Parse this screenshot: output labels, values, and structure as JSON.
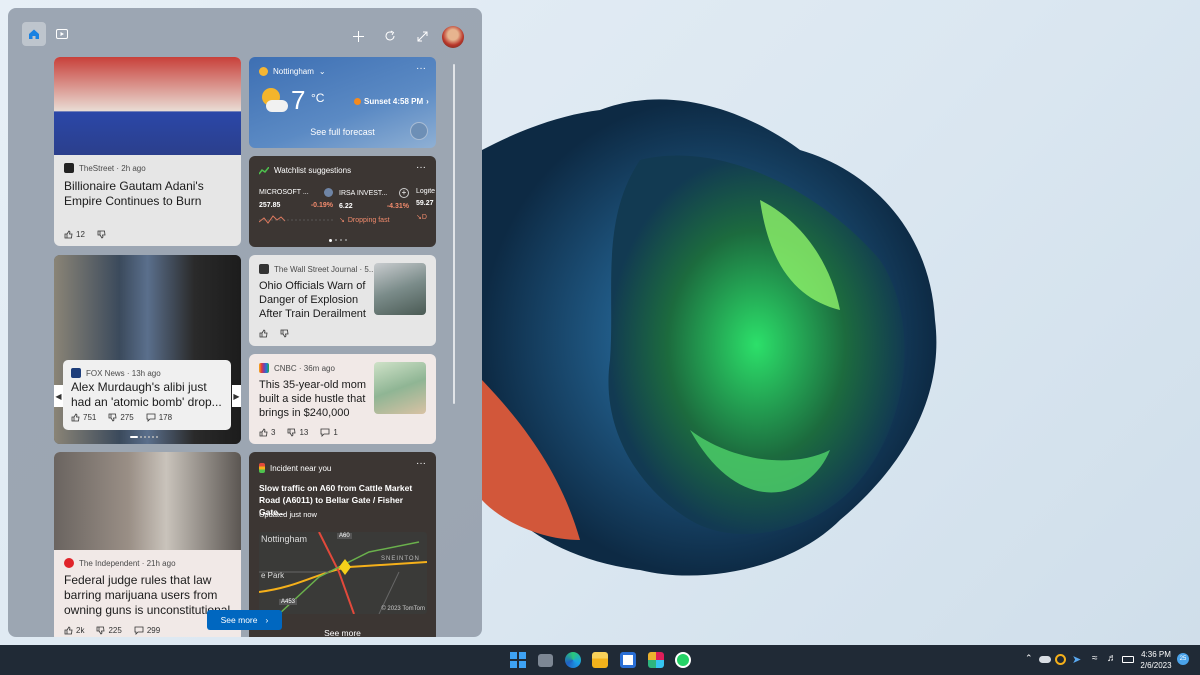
{
  "header": {
    "home_icon": "home-icon",
    "video_icon": "video-icon",
    "add_icon": "plus-icon",
    "refresh_icon": "refresh-icon",
    "expand_icon": "expand-icon"
  },
  "news": [
    {
      "source": "TheStreet · 2h ago",
      "headline": "Billionaire Gautam Adani's Empire Continues to Burn",
      "likes": "12"
    },
    {
      "source": "FOX News · 13h ago",
      "headline": "Alex Murdaugh's alibi just had an 'atomic bomb' drop...",
      "likes": "751",
      "dislikes": "275",
      "comments": "178"
    },
    {
      "source": "The Independent · 21h ago",
      "headline": "Federal judge rules that law barring marijuana users from owning guns is unconstitutional",
      "likes": "2k",
      "dislikes": "225",
      "comments": "299"
    },
    {
      "source": "The Wall Street Journal · 5...",
      "headline": "Ohio Officials Warn of Danger of Explosion After Train Derailment"
    },
    {
      "source": "CNBC · 36m ago",
      "headline": "This 35-year-old mom built a side hustle that brings in $240,000 a...",
      "likes": "3",
      "dislikes": "13",
      "comments": "1"
    }
  ],
  "weather": {
    "location": "Nottingham",
    "temp": "7",
    "unit": "°C",
    "sunset": "Sunset 4:58 PM",
    "forecast": "See full forecast"
  },
  "watchlist": {
    "title": "Watchlist suggestions",
    "stocks": [
      {
        "name": "MICROSOFT ...",
        "price": "257.85",
        "change": "-0.19%"
      },
      {
        "name": "IRSA INVEST...",
        "price": "6.22",
        "change": "-4.31%",
        "note": "Dropping fast"
      },
      {
        "name": "Logite",
        "price": "59.27",
        "note": "D"
      }
    ]
  },
  "incident": {
    "title": "Incident near you",
    "text": "Slow traffic on A60 from Cattle Market Road (A6011) to Bellar Gate / Fisher Gate...",
    "updated": "Updated just now",
    "map_city": "Nottingham",
    "map_area": "SNEINTON",
    "map_park": "e Park",
    "road1": "A60",
    "road2": "A453",
    "copyright": "© 2023 TomTom",
    "see_more": "See more"
  },
  "see_more": "See more",
  "clock": {
    "time": "4:36 PM",
    "date": "2/6/2023",
    "badge": "25"
  },
  "colors": {
    "accent": "#0067c0",
    "panel": "#9aa3ad"
  }
}
